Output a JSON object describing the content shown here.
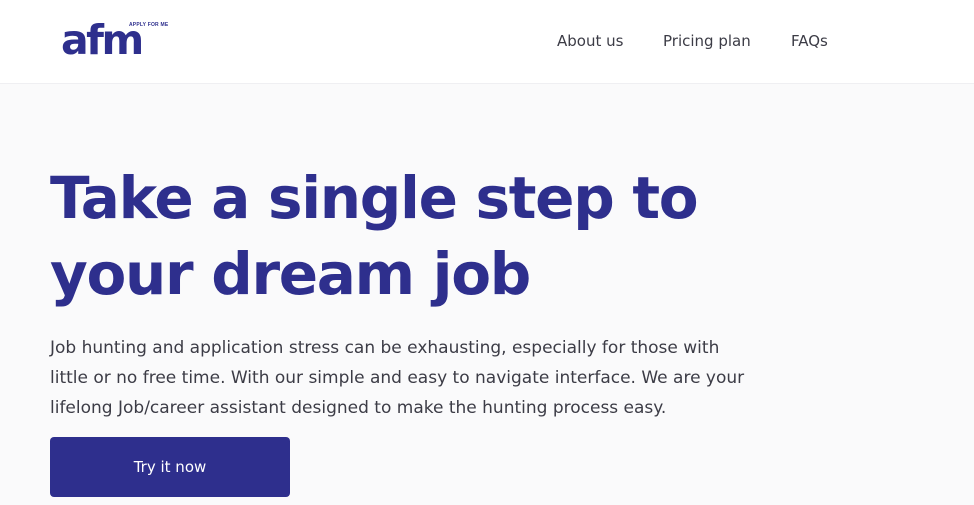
{
  "header": {
    "logo": {
      "wordmark": "afm",
      "tagline": "APPLY FOR ME"
    },
    "nav": [
      {
        "label": "About us"
      },
      {
        "label": "Pricing plan"
      },
      {
        "label": "FAQs"
      }
    ]
  },
  "hero": {
    "title_lines": [
      "Take a single step to",
      "your dream job"
    ],
    "description_lines": [
      "Job hunting and application stress can be exhausting, especially for those with",
      "little or no free time. With our simple and easy to navigate interface. We are your",
      "lifelong Job/career assistant designed to make the hunting process easy."
    ],
    "cta_label": "Try it now"
  },
  "colors": {
    "brand": "#2e2f8d",
    "text": "#3c3c46",
    "background": "#fafafb",
    "header_bg": "#ffffff"
  }
}
